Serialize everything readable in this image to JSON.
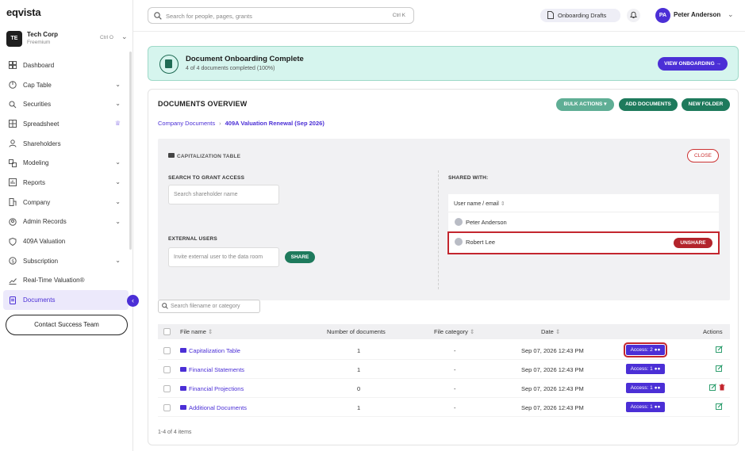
{
  "app": {
    "logo": "eqvista"
  },
  "org": {
    "badge": "TE",
    "name": "Tech Corp",
    "plan": "Freemium",
    "shortcut": "Ctrl O"
  },
  "sidebar": {
    "items": [
      {
        "label": "Dashboard",
        "icon": "dashboard-icon",
        "chevron": false
      },
      {
        "label": "Cap Table",
        "icon": "pie-icon",
        "chevron": true
      },
      {
        "label": "Securities",
        "icon": "securities-icon",
        "chevron": true
      },
      {
        "label": "Spreadsheet",
        "icon": "grid-icon",
        "chevron": false,
        "crown": true
      },
      {
        "label": "Shareholders",
        "icon": "users-icon",
        "chevron": false
      },
      {
        "label": "Modeling",
        "icon": "modeling-icon",
        "chevron": true
      },
      {
        "label": "Reports",
        "icon": "reports-icon",
        "chevron": true
      },
      {
        "label": "Company",
        "icon": "company-icon",
        "chevron": true
      },
      {
        "label": "Admin Records",
        "icon": "records-icon",
        "chevron": true
      },
      {
        "label": "409A Valuation",
        "icon": "shield-icon",
        "chevron": false
      },
      {
        "label": "Subscription",
        "icon": "dollar-icon",
        "chevron": true
      },
      {
        "label": "Real-Time Valuation®",
        "icon": "trend-icon",
        "chevron": false
      },
      {
        "label": "Documents",
        "icon": "documents-icon",
        "chevron": false,
        "active": true
      }
    ],
    "contact_label": "Contact Success Team"
  },
  "topbar": {
    "search_placeholder": "Search for people, pages, grants",
    "search_shortcut": "Ctrl K",
    "drafts_label": "Onboarding Drafts",
    "avatar_initials": "PA",
    "user_name": "Peter Anderson"
  },
  "banner": {
    "title": "Document Onboarding Complete",
    "subtitle": "4 of 4 documents completed (100%)",
    "button": "VIEW ONBOARDING →"
  },
  "documents": {
    "title": "DOCUMENTS OVERVIEW",
    "bulk_label": "BULK ACTIONS",
    "add_label": "ADD DOCUMENTS",
    "folder_label": "NEW FOLDER",
    "breadcrumb_root": "Company Documents",
    "breadcrumb_current": "409A Valuation Renewal (Sep 2026)",
    "panel": {
      "title": "CAPITALIZATION TABLE",
      "close": "CLOSE",
      "search_label": "SEARCH TO GRANT ACCESS",
      "search_placeholder": "Search shareholder name",
      "external_label": "EXTERNAL USERS",
      "external_placeholder": "Invite external user to the data room",
      "share": "SHARE",
      "shared_with": "SHARED WITH:",
      "shared_header": "User name / email",
      "shared_users": [
        "Peter Anderson",
        "Robert Lee"
      ],
      "unshare": "UNSHARE"
    },
    "filter_placeholder": "Search filename or category",
    "columns": [
      "File name",
      "Number of documents",
      "File category",
      "Date",
      "Actions"
    ],
    "rows": [
      {
        "name": "Capitalization Table",
        "count": "1",
        "category": "-",
        "date": "Sep 07, 2026 12:43 PM",
        "access": "Access: 2"
      },
      {
        "name": "Financial Statements",
        "count": "1",
        "category": "-",
        "date": "Sep 07, 2026 12:43 PM",
        "access": "Access: 1"
      },
      {
        "name": "Financial Projections",
        "count": "0",
        "category": "-",
        "date": "Sep 07, 2026 12:43 PM",
        "access": "Access: 1"
      },
      {
        "name": "Additional Documents",
        "count": "1",
        "category": "-",
        "date": "Sep 07, 2026 12:43 PM",
        "access": "Access: 1"
      }
    ],
    "footer": "1-4 of 4 items"
  },
  "colors": {
    "accent": "#4b2fd6",
    "green": "#1e7a5c",
    "danger": "#b3232b",
    "banner_bg": "#d6f5ee"
  }
}
